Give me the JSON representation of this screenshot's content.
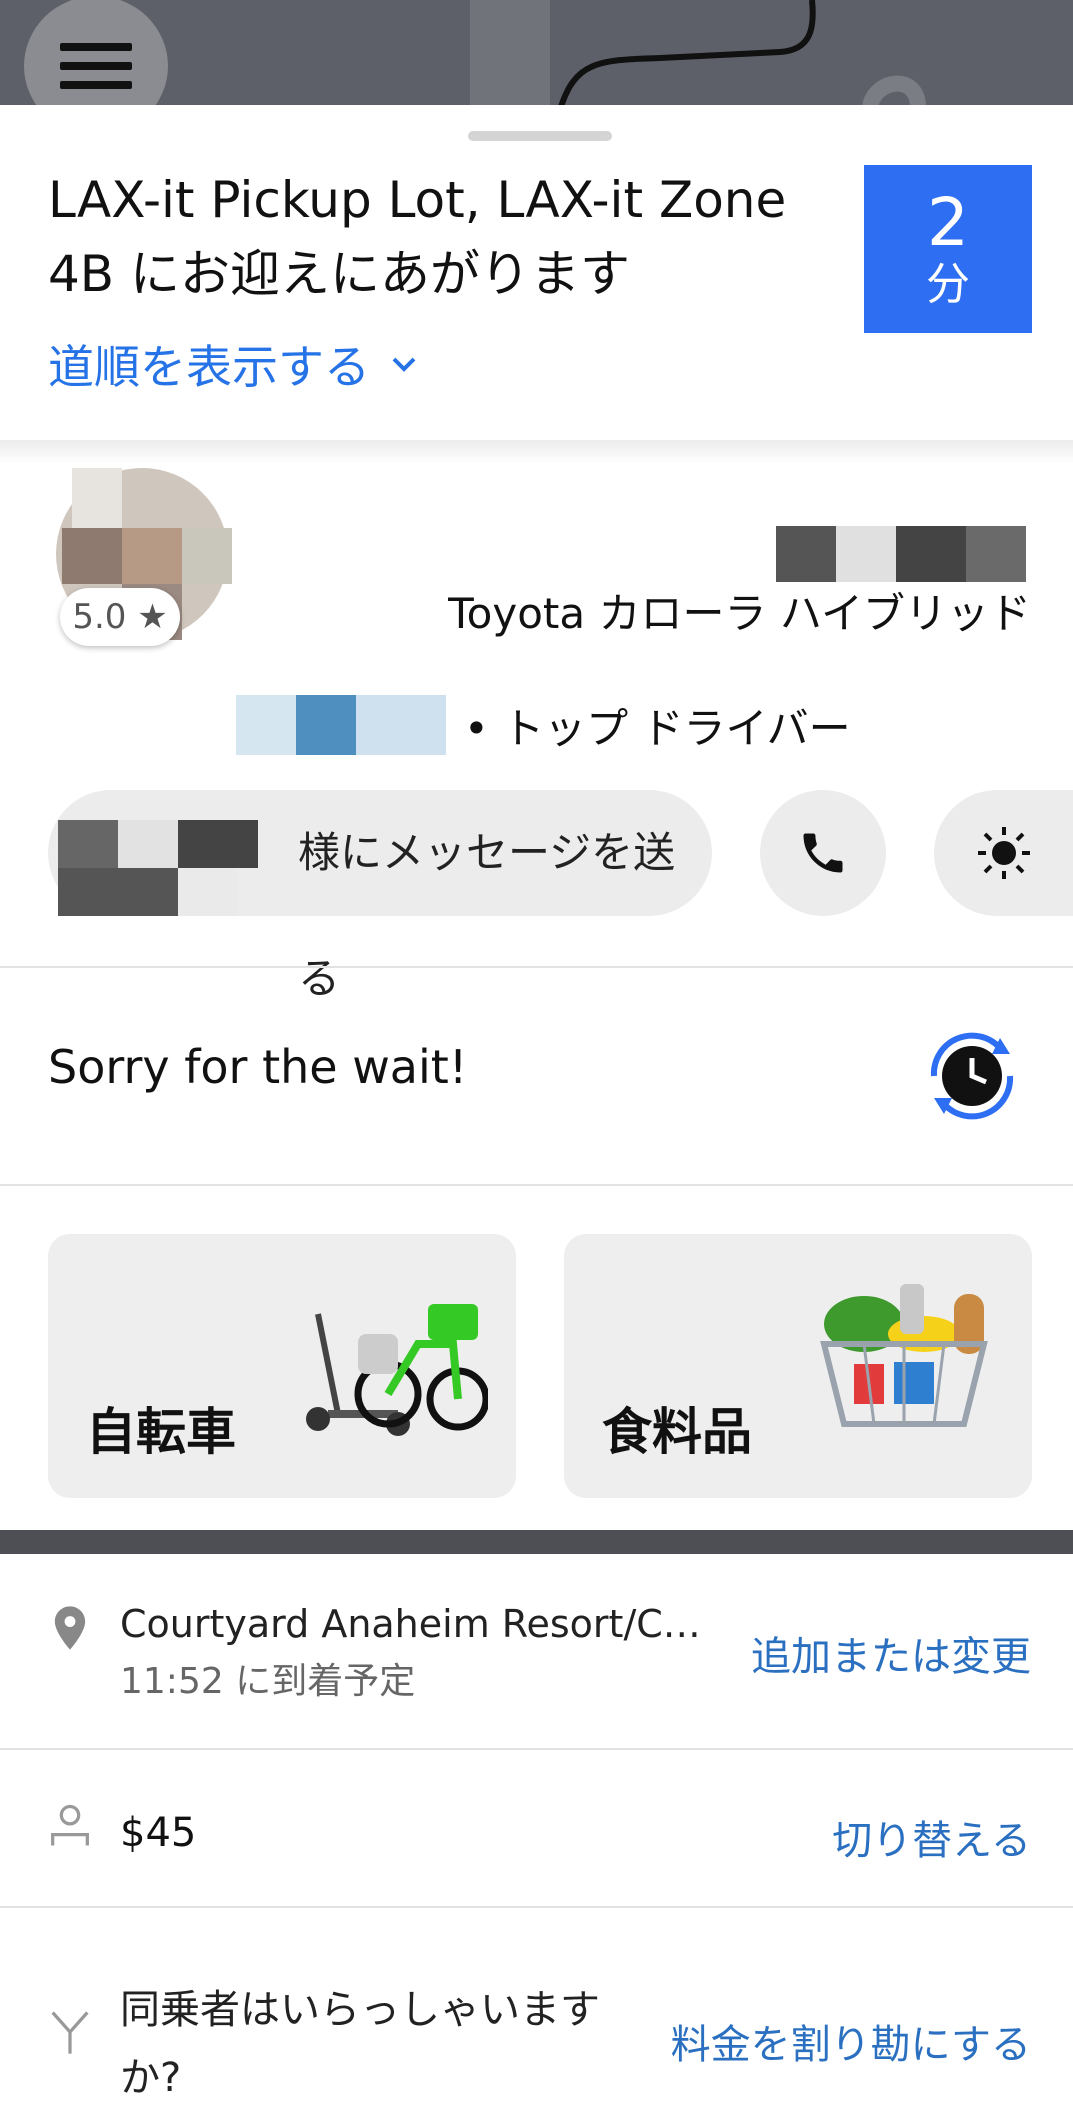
{
  "menu": {
    "icon": "hamburger-menu-icon"
  },
  "pickup": {
    "title": "LAX-it Pickup Lot, LAX-it Zone 4B にお迎えにあがります",
    "directions_label": "道順を表示する",
    "eta_value": "2",
    "eta_unit": "分"
  },
  "driver": {
    "rating": "5.0 ★",
    "car_model": "Toyota カローラ ハイブリッド",
    "badge": "• トップ ドライバー",
    "message_label": "様にメッセージを送る"
  },
  "status": {
    "message": "Sorry for the wait!"
  },
  "tiles": [
    {
      "label": "自転車",
      "icon": "bike-scooter-icon"
    },
    {
      "label": "食料品",
      "icon": "grocery-basket-icon"
    }
  ],
  "trip": {
    "destination": "Courtyard Anaheim Resort/Con...",
    "arrival": "11:52 に到着予定",
    "destination_action": "追加または変更",
    "fare": "$45",
    "fare_action": "切り替える",
    "share_question": "同乗者はいらっしゃいますか?",
    "share_action": "料金を割り勘にする"
  },
  "colors": {
    "accent": "#2E6EF2",
    "link": "#2A6FC0",
    "tile_bg": "#EEEEEE"
  }
}
